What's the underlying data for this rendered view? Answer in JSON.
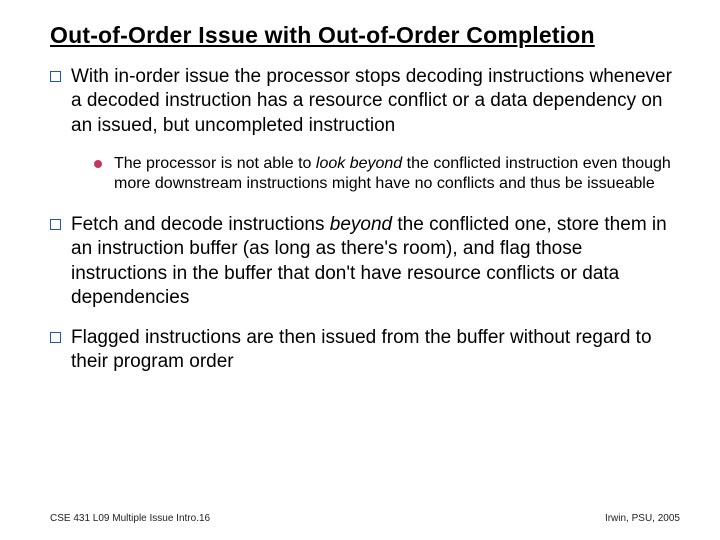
{
  "title": "Out-of-Order Issue with Out-of-Order Completion",
  "bullets": {
    "b1": {
      "pre": "With in-order issue the processor stops decoding instructions whenever a decoded instruction has a resource conflict or a data dependency on an issued, but uncompleted instruction"
    },
    "sub1": {
      "pre": "The processor is not able to ",
      "em": "look beyond",
      "post": " the conflicted instruction even though more downstream instructions might have no conflicts and thus be issueable"
    },
    "b2": {
      "pre": "Fetch and decode instructions ",
      "em": "beyond",
      "post": " the conflicted one, store them in an instruction buffer (as long as there's room), and flag those instructions in the buffer that don't have resource conflicts or data dependencies"
    },
    "b3": {
      "pre": "Flagged instructions are then issued from the buffer without regard to their program order"
    }
  },
  "footer": {
    "left": "CSE 431  L09 Multiple Issue Intro.16",
    "right": "Irwin, PSU, 2005"
  }
}
